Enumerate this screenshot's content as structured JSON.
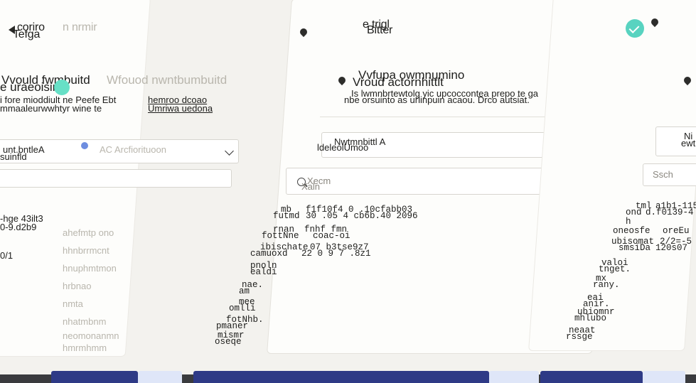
{
  "left": {
    "title_a": "coriro",
    "title_b": "Tefga",
    "title_ghost": "n nrmir",
    "heading": "Vvould fwmbuitd",
    "heading_b": "e uraeoisinte",
    "heading_ghost": "Wfouod nwntbumbuitd",
    "desc_1": "i fore mioddiult ne Peefe Ebt",
    "desc_1_link": "hemroo dcoao",
    "desc_2": "mmaaleurwwhtyr wine te",
    "desc_2_link": "Umriwa uedona",
    "select_label": "unt.bntleA",
    "select_sub": "suinfld",
    "select_ghost": "AC Arcfiorituoon",
    "list_1": "-hge 43ilt3",
    "list_2": "0-9.d2b9",
    "list_3": "0/1",
    "ghost_lines": [
      "ahefmtp ono",
      "hhnbrrmcnt",
      "hnuphmtmon",
      "hrbnao",
      "nmta",
      "nhatmbnm",
      "neomonanmn",
      "hmrmhmm"
    ]
  },
  "center": {
    "title": "e trigl",
    "title_b": "Bitter",
    "heading": "Vvfupa owmnumino",
    "heading_b": "Vroud actornhittlt",
    "desc_1": "Is lwmnbrtewtolg yic upcoccontea prepo te ga",
    "desc_2": "nbe orsuinto as urlinpuin acaou. Drco autsiat.",
    "select_top": "Nwtmnbittl A",
    "select_bottom": "ldeleolUmoo",
    "search_placeholder": "Xecm",
    "search_sub": "Xaln",
    "rows": [
      {
        "key": "mb",
        "value": "f1f10f4 0 .10cfabb03"
      },
      {
        "key": "futmd",
        "value": "30 .05 4 cb6b.40 2096"
      },
      {
        "key": "rnan",
        "value": "fnhf fmn"
      },
      {
        "key": "fottNne",
        "value": "coac-oi"
      },
      {
        "key": "ibischate",
        "value": "07 b3tse9z7"
      },
      {
        "key": "camuoxd",
        "value": "22 0 9 7 .8z1"
      },
      {
        "key": "pnoln",
        "value": ""
      },
      {
        "key": "ealdi",
        "value": ""
      },
      {
        "key": "nae.",
        "value": ""
      },
      {
        "key": "am",
        "value": ""
      },
      {
        "key": "mee",
        "value": ""
      },
      {
        "key": "omlli",
        "value": ""
      },
      {
        "key": "fotNhb.",
        "value": ""
      },
      {
        "key": "pmaner",
        "value": ""
      },
      {
        "key": "mismr",
        "value": ""
      },
      {
        "key": "oseqe",
        "value": ""
      }
    ]
  },
  "right": {
    "select_label": "Ni",
    "select_sub": "ewt",
    "search_placeholder": "Ssch",
    "rows": [
      {
        "key": "tml",
        "value": "a1b1-1151"
      },
      {
        "key": "ond",
        "value": "d.f0139-4"
      },
      {
        "key": "h",
        "value": ""
      },
      {
        "key": "oneosfe",
        "value": "oreEu"
      },
      {
        "key": "ubisomat",
        "value": "2/2=-5"
      },
      {
        "key": "smsiDa",
        "value": "120s07"
      },
      {
        "key": "valoi",
        "value": ""
      },
      {
        "key": "tnget.",
        "value": ""
      },
      {
        "key": "mx",
        "value": ""
      },
      {
        "key": "rany.",
        "value": ""
      },
      {
        "key": "eai",
        "value": ""
      },
      {
        "key": "anir.",
        "value": ""
      },
      {
        "key": "ubiomnr",
        "value": ""
      },
      {
        "key": "mhlubo",
        "value": ""
      },
      {
        "key": "neaat",
        "value": ""
      },
      {
        "key": "rssge",
        "value": ""
      }
    ]
  },
  "colors": {
    "accent": "#58d3c0",
    "primary_button": "#2e3a86",
    "secondary_button": "#dfe6f8",
    "background": "#f3f2ee"
  },
  "icons": [
    "back-arrow-icon",
    "check-icon",
    "pin-icon",
    "chevron-down-icon",
    "search-icon",
    "status-dot-icon"
  ]
}
